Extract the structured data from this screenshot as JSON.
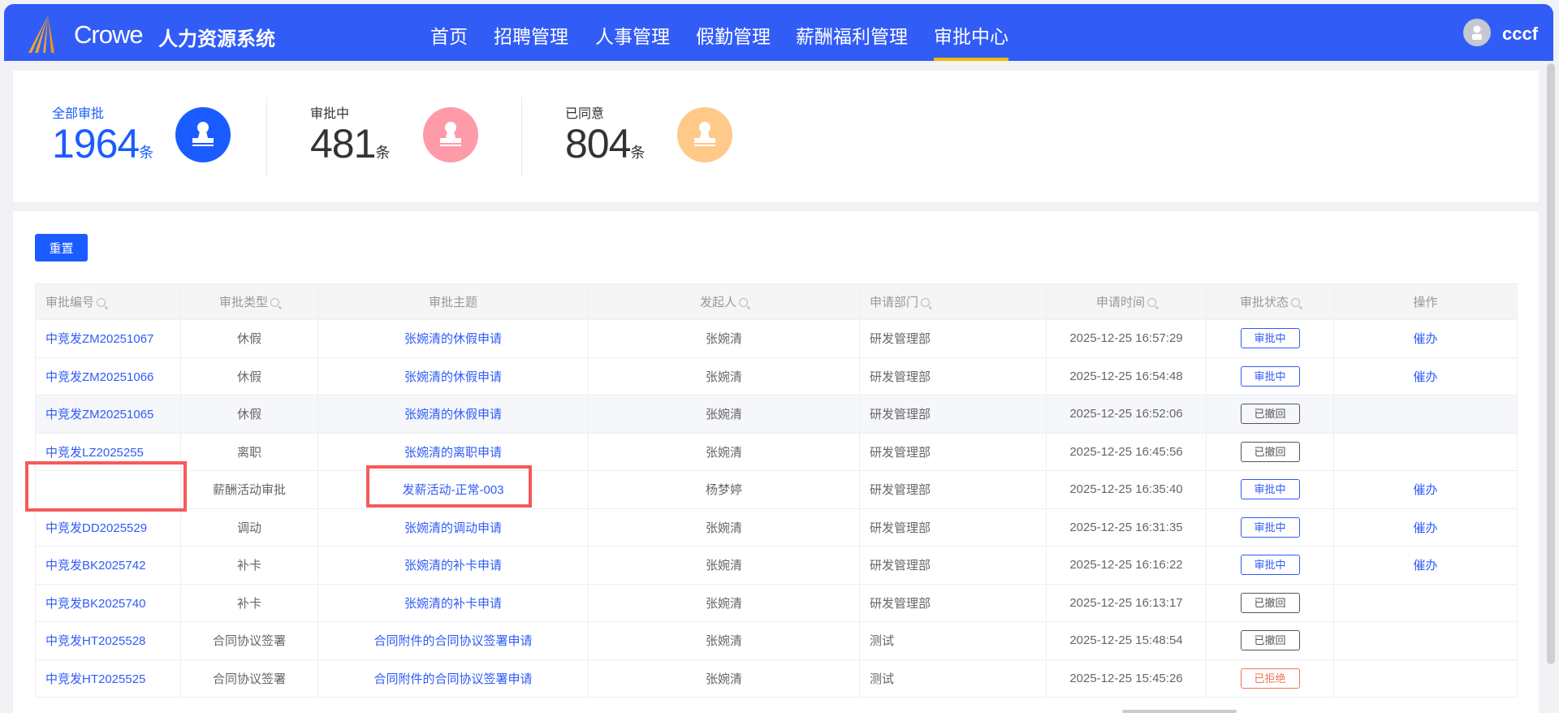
{
  "header": {
    "brand": "Crowe",
    "system": "人力资源系统",
    "nav": [
      {
        "label": "首页"
      },
      {
        "label": "招聘管理"
      },
      {
        "label": "人事管理"
      },
      {
        "label": "假勤管理"
      },
      {
        "label": "薪酬福利管理"
      },
      {
        "label": "审批中心",
        "active": true
      }
    ],
    "user": "cccf"
  },
  "stats": [
    {
      "label": "全部审批",
      "value": "1964",
      "unit": "条",
      "color": "#1a5cff"
    },
    {
      "label": "审批中",
      "value": "481",
      "unit": "条",
      "color": "#ff9aa8"
    },
    {
      "label": "已同意",
      "value": "804",
      "unit": "条",
      "color": "#ffc98a"
    }
  ],
  "reset_label": "重置",
  "table": {
    "columns": [
      {
        "label": "审批编号",
        "search": true
      },
      {
        "label": "审批类型",
        "search": true
      },
      {
        "label": "审批主题",
        "search": false
      },
      {
        "label": "发起人",
        "search": true
      },
      {
        "label": "申请部门",
        "search": true
      },
      {
        "label": "申请时间",
        "search": true
      },
      {
        "label": "审批状态",
        "search": true
      },
      {
        "label": "操作",
        "search": false
      }
    ],
    "rows": [
      [
        "中竞发ZM20251067",
        "休假",
        "张婉清的休假申请",
        "张婉清",
        "研发管理部",
        "2025-12-25 16:57:29",
        "审批中",
        "催办"
      ],
      [
        "中竞发ZM20251066",
        "休假",
        "张婉清的休假申请",
        "张婉清",
        "研发管理部",
        "2025-12-25 16:54:48",
        "审批中",
        "催办"
      ],
      [
        "中竞发ZM20251065",
        "休假",
        "张婉清的休假申请",
        "张婉清",
        "研发管理部",
        "2025-12-25 16:52:06",
        "已撤回",
        ""
      ],
      [
        "中竞发LZ2025255",
        "离职",
        "张婉清的离职申请",
        "张婉清",
        "研发管理部",
        "2025-12-25 16:45:56",
        "已撤回",
        ""
      ],
      [
        "",
        "薪酬活动审批",
        "发薪活动-正常-003",
        "杨梦婷",
        "研发管理部",
        "2025-12-25 16:35:40",
        "审批中",
        "催办"
      ],
      [
        "中竞发DD2025529",
        "调动",
        "张婉清的调动申请",
        "张婉清",
        "研发管理部",
        "2025-12-25 16:31:35",
        "审批中",
        "催办"
      ],
      [
        "中竞发BK2025742",
        "补卡",
        "张婉清的补卡申请",
        "张婉清",
        "研发管理部",
        "2025-12-25 16:16:22",
        "审批中",
        "催办"
      ],
      [
        "中竞发BK2025740",
        "补卡",
        "张婉清的补卡申请",
        "张婉清",
        "研发管理部",
        "2025-12-25 16:13:17",
        "已撤回",
        ""
      ],
      [
        "中竞发HT2025528",
        "合同协议签署",
        "合同附件的合同协议签署申请",
        "张婉清",
        "测试",
        "2025-12-25 15:48:54",
        "已撤回",
        ""
      ],
      [
        "中竞发HT2025525",
        "合同协议签署",
        "合同附件的合同协议签署申请",
        "张婉清",
        "测试",
        "2025-12-25 15:45:26",
        "已拒绝",
        ""
      ]
    ]
  },
  "status_colors": {
    "审批中": "#2f5cf6",
    "已撤回": "#555555",
    "已拒绝": "#f0764f"
  }
}
